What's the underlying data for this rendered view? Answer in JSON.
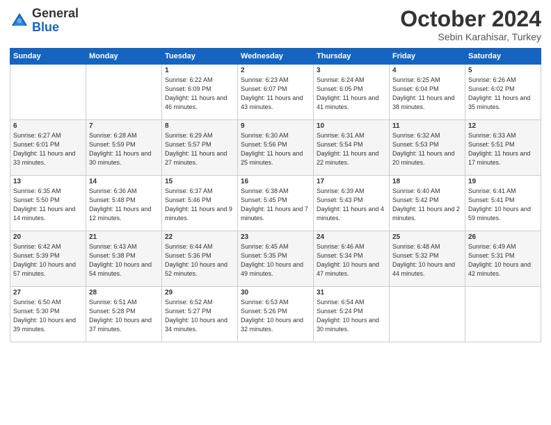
{
  "header": {
    "logo_general": "General",
    "logo_blue": "Blue",
    "month": "October 2024",
    "location": "Sebin Karahisar, Turkey"
  },
  "days_of_week": [
    "Sunday",
    "Monday",
    "Tuesday",
    "Wednesday",
    "Thursday",
    "Friday",
    "Saturday"
  ],
  "weeks": [
    [
      {
        "day": "",
        "sunrise": "",
        "sunset": "",
        "daylight": ""
      },
      {
        "day": "",
        "sunrise": "",
        "sunset": "",
        "daylight": ""
      },
      {
        "day": "1",
        "sunrise": "Sunrise: 6:22 AM",
        "sunset": "Sunset: 6:09 PM",
        "daylight": "Daylight: 11 hours and 46 minutes."
      },
      {
        "day": "2",
        "sunrise": "Sunrise: 6:23 AM",
        "sunset": "Sunset: 6:07 PM",
        "daylight": "Daylight: 11 hours and 43 minutes."
      },
      {
        "day": "3",
        "sunrise": "Sunrise: 6:24 AM",
        "sunset": "Sunset: 6:05 PM",
        "daylight": "Daylight: 11 hours and 41 minutes."
      },
      {
        "day": "4",
        "sunrise": "Sunrise: 6:25 AM",
        "sunset": "Sunset: 6:04 PM",
        "daylight": "Daylight: 11 hours and 38 minutes."
      },
      {
        "day": "5",
        "sunrise": "Sunrise: 6:26 AM",
        "sunset": "Sunset: 6:02 PM",
        "daylight": "Daylight: 11 hours and 35 minutes."
      }
    ],
    [
      {
        "day": "6",
        "sunrise": "Sunrise: 6:27 AM",
        "sunset": "Sunset: 6:01 PM",
        "daylight": "Daylight: 11 hours and 33 minutes."
      },
      {
        "day": "7",
        "sunrise": "Sunrise: 6:28 AM",
        "sunset": "Sunset: 5:59 PM",
        "daylight": "Daylight: 11 hours and 30 minutes."
      },
      {
        "day": "8",
        "sunrise": "Sunrise: 6:29 AM",
        "sunset": "Sunset: 5:57 PM",
        "daylight": "Daylight: 11 hours and 27 minutes."
      },
      {
        "day": "9",
        "sunrise": "Sunrise: 6:30 AM",
        "sunset": "Sunset: 5:56 PM",
        "daylight": "Daylight: 11 hours and 25 minutes."
      },
      {
        "day": "10",
        "sunrise": "Sunrise: 6:31 AM",
        "sunset": "Sunset: 5:54 PM",
        "daylight": "Daylight: 11 hours and 22 minutes."
      },
      {
        "day": "11",
        "sunrise": "Sunrise: 6:32 AM",
        "sunset": "Sunset: 5:53 PM",
        "daylight": "Daylight: 11 hours and 20 minutes."
      },
      {
        "day": "12",
        "sunrise": "Sunrise: 6:33 AM",
        "sunset": "Sunset: 5:51 PM",
        "daylight": "Daylight: 11 hours and 17 minutes."
      }
    ],
    [
      {
        "day": "13",
        "sunrise": "Sunrise: 6:35 AM",
        "sunset": "Sunset: 5:50 PM",
        "daylight": "Daylight: 11 hours and 14 minutes."
      },
      {
        "day": "14",
        "sunrise": "Sunrise: 6:36 AM",
        "sunset": "Sunset: 5:48 PM",
        "daylight": "Daylight: 11 hours and 12 minutes."
      },
      {
        "day": "15",
        "sunrise": "Sunrise: 6:37 AM",
        "sunset": "Sunset: 5:46 PM",
        "daylight": "Daylight: 11 hours and 9 minutes."
      },
      {
        "day": "16",
        "sunrise": "Sunrise: 6:38 AM",
        "sunset": "Sunset: 5:45 PM",
        "daylight": "Daylight: 11 hours and 7 minutes."
      },
      {
        "day": "17",
        "sunrise": "Sunrise: 6:39 AM",
        "sunset": "Sunset: 5:43 PM",
        "daylight": "Daylight: 11 hours and 4 minutes."
      },
      {
        "day": "18",
        "sunrise": "Sunrise: 6:40 AM",
        "sunset": "Sunset: 5:42 PM",
        "daylight": "Daylight: 11 hours and 2 minutes."
      },
      {
        "day": "19",
        "sunrise": "Sunrise: 6:41 AM",
        "sunset": "Sunset: 5:41 PM",
        "daylight": "Daylight: 10 hours and 59 minutes."
      }
    ],
    [
      {
        "day": "20",
        "sunrise": "Sunrise: 6:42 AM",
        "sunset": "Sunset: 5:39 PM",
        "daylight": "Daylight: 10 hours and 57 minutes."
      },
      {
        "day": "21",
        "sunrise": "Sunrise: 6:43 AM",
        "sunset": "Sunset: 5:38 PM",
        "daylight": "Daylight: 10 hours and 54 minutes."
      },
      {
        "day": "22",
        "sunrise": "Sunrise: 6:44 AM",
        "sunset": "Sunset: 5:36 PM",
        "daylight": "Daylight: 10 hours and 52 minutes."
      },
      {
        "day": "23",
        "sunrise": "Sunrise: 6:45 AM",
        "sunset": "Sunset: 5:35 PM",
        "daylight": "Daylight: 10 hours and 49 minutes."
      },
      {
        "day": "24",
        "sunrise": "Sunrise: 6:46 AM",
        "sunset": "Sunset: 5:34 PM",
        "daylight": "Daylight: 10 hours and 47 minutes."
      },
      {
        "day": "25",
        "sunrise": "Sunrise: 6:48 AM",
        "sunset": "Sunset: 5:32 PM",
        "daylight": "Daylight: 10 hours and 44 minutes."
      },
      {
        "day": "26",
        "sunrise": "Sunrise: 6:49 AM",
        "sunset": "Sunset: 5:31 PM",
        "daylight": "Daylight: 10 hours and 42 minutes."
      }
    ],
    [
      {
        "day": "27",
        "sunrise": "Sunrise: 6:50 AM",
        "sunset": "Sunset: 5:30 PM",
        "daylight": "Daylight: 10 hours and 39 minutes."
      },
      {
        "day": "28",
        "sunrise": "Sunrise: 6:51 AM",
        "sunset": "Sunset: 5:28 PM",
        "daylight": "Daylight: 10 hours and 37 minutes."
      },
      {
        "day": "29",
        "sunrise": "Sunrise: 6:52 AM",
        "sunset": "Sunset: 5:27 PM",
        "daylight": "Daylight: 10 hours and 34 minutes."
      },
      {
        "day": "30",
        "sunrise": "Sunrise: 6:53 AM",
        "sunset": "Sunset: 5:26 PM",
        "daylight": "Daylight: 10 hours and 32 minutes."
      },
      {
        "day": "31",
        "sunrise": "Sunrise: 6:54 AM",
        "sunset": "Sunset: 5:24 PM",
        "daylight": "Daylight: 10 hours and 30 minutes."
      },
      {
        "day": "",
        "sunrise": "",
        "sunset": "",
        "daylight": ""
      },
      {
        "day": "",
        "sunrise": "",
        "sunset": "",
        "daylight": ""
      }
    ]
  ]
}
